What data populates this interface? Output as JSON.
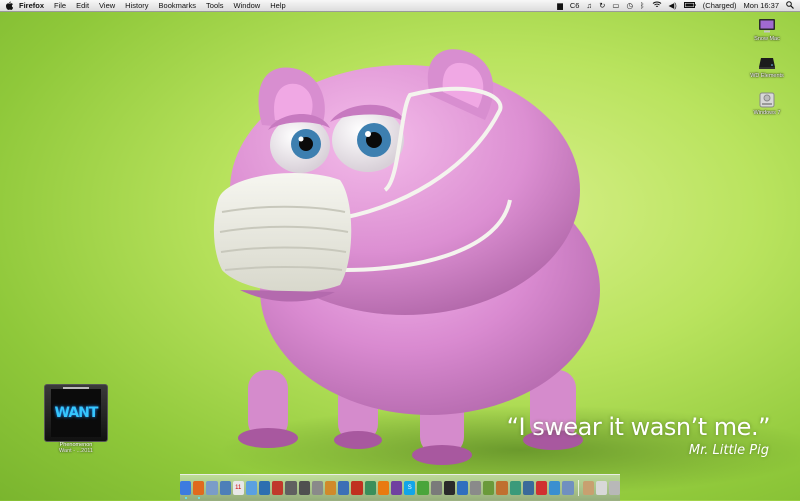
{
  "menubar": {
    "app_name": "Firefox",
    "menus": [
      "File",
      "Edit",
      "View",
      "History",
      "Bookmarks",
      "Tools",
      "Window",
      "Help"
    ],
    "extras": {
      "cpu_label": "C6",
      "battery_status": "(Charged)",
      "clock": "Mon 16:37"
    }
  },
  "desktop_icons": [
    {
      "label": "Snow Mac"
    },
    {
      "label": "WD Elements"
    },
    {
      "label": "Windows 7"
    }
  ],
  "album": {
    "cover_word": "WANT",
    "title": "Phenomenon",
    "subtitle": "Want - ...2011"
  },
  "wallpaper": {
    "quote": "“I swear it wasn’t me.”",
    "attribution": "Mr. Little Pig"
  },
  "dock": {
    "apps": [
      {
        "icon": "finder-icon",
        "color": "#3d7be0"
      },
      {
        "icon": "firefox-icon",
        "color": "#e06a1e"
      },
      {
        "icon": "mail-icon",
        "color": "#7a9cc8"
      },
      {
        "icon": "preview-icon",
        "color": "#4d7fb8"
      },
      {
        "icon": "calendar-icon",
        "color": "#e8e8e8",
        "text": "11"
      },
      {
        "icon": "itunes-icon",
        "color": "#5aa0e0"
      },
      {
        "icon": "photo-icon",
        "color": "#2d6fb0"
      },
      {
        "icon": "flashcard-icon",
        "color": "#c0392b"
      },
      {
        "icon": "chess-icon",
        "color": "#606060"
      },
      {
        "icon": "star-icon",
        "color": "#505050"
      },
      {
        "icon": "tools-icon",
        "color": "#8a8a8a"
      },
      {
        "icon": "browser-icon",
        "color": "#d08a2a"
      },
      {
        "icon": "virtualbox-icon",
        "color": "#3c6fb6"
      },
      {
        "icon": "parallels-icon",
        "color": "#c03020"
      },
      {
        "icon": "globe-icon",
        "color": "#3a8f5a"
      },
      {
        "icon": "vlc-icon",
        "color": "#e87a10"
      },
      {
        "icon": "notes-icon",
        "color": "#7040a0"
      },
      {
        "icon": "skype-icon",
        "color": "#12a5e8",
        "text": "S"
      },
      {
        "icon": "leaf-icon",
        "color": "#4aa53a"
      },
      {
        "icon": "system-prefs-icon",
        "color": "#7a7a7a"
      },
      {
        "icon": "terminal-icon",
        "color": "#2a2a2a"
      },
      {
        "icon": "network-icon",
        "color": "#2f6fbf"
      },
      {
        "icon": "script-icon",
        "color": "#8a8a8a"
      },
      {
        "icon": "inkscape-icon",
        "color": "#6a9a3a"
      },
      {
        "icon": "pen-icon",
        "color": "#c07030"
      },
      {
        "icon": "arrow-icon",
        "color": "#3a9a7a"
      },
      {
        "icon": "activity-icon",
        "color": "#3a6a9a"
      },
      {
        "icon": "target-icon",
        "color": "#d03030"
      },
      {
        "icon": "safari-icon",
        "color": "#3a8fd0"
      },
      {
        "icon": "folder-icon",
        "color": "#7090c0"
      }
    ],
    "stacks": [
      {
        "icon": "documents-icon",
        "color": "#c8a070"
      },
      {
        "icon": "downloads-icon",
        "color": "#d8d8d8"
      },
      {
        "icon": "trash-icon",
        "color": "#b8b8b8"
      }
    ]
  }
}
